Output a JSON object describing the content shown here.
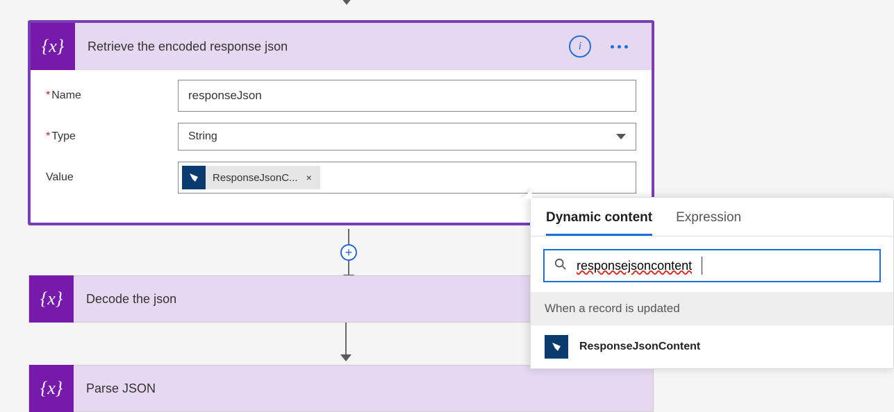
{
  "colors": {
    "accent_purple": "#7a3db5",
    "accent_blue": "#1f6fd6",
    "dark_blue": "#0b3a6e",
    "header_lilac": "#e7d8f2"
  },
  "step1": {
    "title": "Retrieve the encoded response json",
    "icon_glyph": "{x}",
    "fields": {
      "name_label": "Name",
      "name_value": "responseJson",
      "type_label": "Type",
      "type_value": "String",
      "value_label": "Value"
    },
    "value_token": {
      "label": "ResponseJsonC...",
      "close": "×"
    },
    "add_link": "Add "
  },
  "step2": {
    "title": "Decode the json",
    "icon_glyph": "{x}"
  },
  "step3": {
    "title": "Parse JSON",
    "icon_glyph": "{x}"
  },
  "dynamic_panel": {
    "tabs": {
      "dynamic": "Dynamic content",
      "expression": "Expression"
    },
    "search_value": "responsejsoncontent",
    "group_header": "When a record is updated",
    "item_label": "ResponseJsonContent"
  }
}
